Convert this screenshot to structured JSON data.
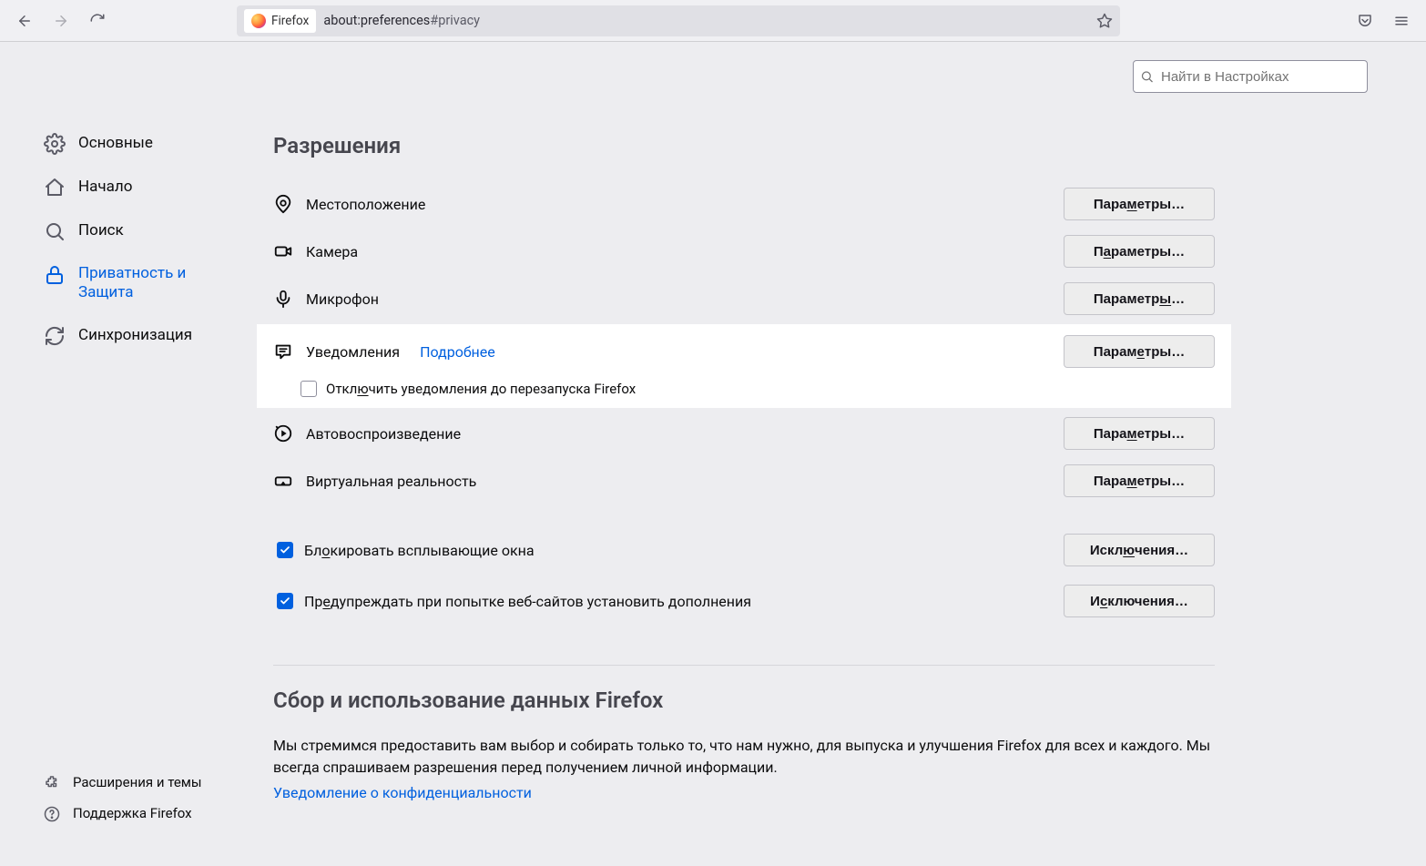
{
  "toolbar": {
    "identity_label": "Firefox",
    "url_prefix": "about:preferences",
    "url_suffix": "#privacy"
  },
  "search": {
    "placeholder": "Найти в Настройках"
  },
  "sidebar": {
    "items": [
      {
        "label": "Основные"
      },
      {
        "label": "Начало"
      },
      {
        "label": "Поиск"
      },
      {
        "label": "Приватность и Защита"
      },
      {
        "label": "Синхронизация"
      }
    ],
    "bottom": [
      {
        "label": "Расширения и темы"
      },
      {
        "label": "Поддержка Firefox"
      }
    ]
  },
  "sections": {
    "permissions_title": "Разрешения",
    "data_title": "Сбор и использование данных Firefox",
    "data_p1": "Мы стремимся предоставить вам выбор и собирать только то, что нам нужно, для выпуска и улучшения Firefox для всех и каждого. Мы всегда спрашиваем разрешения перед получением личной информации.",
    "data_link": "Уведомление о конфиденциальности"
  },
  "permissions": {
    "location": {
      "label": "Местоположение",
      "btn_pre": "Пара",
      "btn_u": "м",
      "btn_post": "етры…"
    },
    "camera": {
      "label": "Камера",
      "btn_pre": "П",
      "btn_u": "а",
      "btn_post": "раметры…"
    },
    "microphone": {
      "label": "Микрофон",
      "btn_pre": "Параметр",
      "btn_u": "ы",
      "btn_post": "…"
    },
    "notifications": {
      "label": "Уведомления",
      "learn_more": "Подробнее",
      "btn_pre": "Парам",
      "btn_u": "е",
      "btn_post": "тры…",
      "pause_pre": "Откл",
      "pause_u": "ю",
      "pause_post": "чить уведомления до перезапуска Firefox"
    },
    "autoplay": {
      "label": "Автовоспроизведение",
      "btn_pre": "Пара",
      "btn_u": "м",
      "btn_post": "етры…"
    },
    "vr": {
      "label": "Виртуальная реальность",
      "btn_pre": "Пара",
      "btn_u": "м",
      "btn_post": "етры…"
    },
    "popups": {
      "label_pre": "Бл",
      "label_u": "о",
      "label_post": "кировать всплывающие окна",
      "btn_pre": "Искл",
      "btn_u": "ю",
      "btn_post": "чения…"
    },
    "addons": {
      "label_pre": "Пр",
      "label_u": "е",
      "label_post": "дупреждать при попытке веб-сайтов установить дополнения",
      "btn_pre": "И",
      "btn_u": "с",
      "btn_post": "ключения…"
    }
  }
}
